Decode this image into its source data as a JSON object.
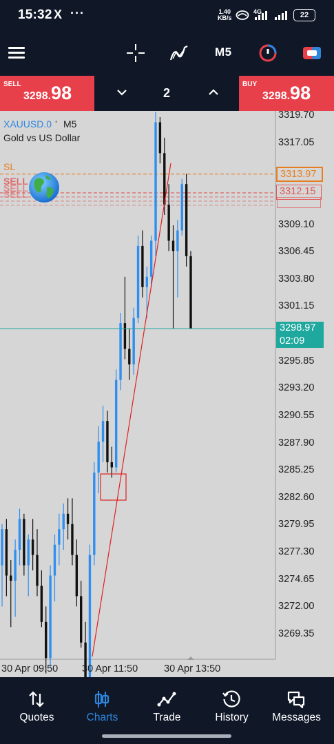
{
  "status_bar": {
    "time": "15:32",
    "x_icon": "X",
    "dots": "···",
    "speed_value": "1.40",
    "speed_unit": "KB/s",
    "network": "4G",
    "battery": "22"
  },
  "toolbar": {
    "timeframe": "M5"
  },
  "trade_panel": {
    "sell_label": "SELL",
    "sell_price_small": "3298.",
    "sell_price_big": "98",
    "lot": "2",
    "buy_label": "BUY",
    "buy_price_small": "3298.",
    "buy_price_big": "98"
  },
  "chart": {
    "symbol": "XAUUSD.0",
    "timeframe": "M5",
    "description": "Gold vs US Dollar",
    "sl_label": "SL",
    "sell_tag": "SELL",
    "sl_price": "3313.97",
    "sell_price": "3312.15",
    "current_price": "3298.97",
    "countdown": "02:09",
    "price_ticks": [
      "3319.70",
      "3317.05",
      "3309.10",
      "3306.45",
      "3303.80",
      "3301.15",
      "3295.85",
      "3293.20",
      "3290.55",
      "3287.90",
      "3285.25",
      "3282.60",
      "3279.95",
      "3277.30",
      "3274.65",
      "3272.00",
      "3269.35"
    ],
    "time_ticks": [
      "30 Apr 09:50",
      "30 Apr 11:50",
      "30 Apr 13:50"
    ],
    "colors": {
      "bull": "#2e8ff0",
      "bear": "#111111",
      "sl": "#e67e22",
      "sell": "#e05a5a",
      "bid_line": "#1fa89e"
    }
  },
  "chart_data": {
    "type": "candlestick",
    "symbol": "XAUUSD.0",
    "timeframe": "M5",
    "ylim": [
      3268.0,
      3321.0
    ],
    "candles": [
      [
        3276.0,
        3280.0,
        3272.0,
        3279.5
      ],
      [
        3279.5,
        3280.5,
        3273.0,
        3275.0
      ],
      [
        3275.0,
        3276.5,
        3270.0,
        3274.5
      ],
      [
        3274.5,
        3278.5,
        3271.0,
        3277.5
      ],
      [
        3277.5,
        3281.5,
        3276.0,
        3280.5
      ],
      [
        3280.5,
        3281.0,
        3275.0,
        3276.0
      ],
      [
        3276.0,
        3279.0,
        3273.0,
        3278.5
      ],
      [
        3278.5,
        3280.5,
        3275.5,
        3277.0
      ],
      [
        3277.0,
        3279.5,
        3273.0,
        3274.0
      ],
      [
        3274.0,
        3275.5,
        3270.0,
        3270.5
      ],
      [
        3270.5,
        3272.0,
        3265.5,
        3267.0
      ],
      [
        3267.0,
        3276.0,
        3266.0,
        3275.0
      ],
      [
        3275.0,
        3279.0,
        3272.5,
        3278.0
      ],
      [
        3278.0,
        3281.0,
        3276.0,
        3279.5
      ],
      [
        3279.5,
        3282.0,
        3277.5,
        3281.0
      ],
      [
        3281.0,
        3282.5,
        3278.5,
        3280.0
      ],
      [
        3280.0,
        3282.5,
        3276.0,
        3277.0
      ],
      [
        3277.0,
        3278.5,
        3272.0,
        3273.0
      ],
      [
        3273.0,
        3274.5,
        3268.0,
        3268.5
      ],
      [
        3268.5,
        3270.5,
        3264.5,
        3265.0
      ],
      [
        3265.0,
        3278.0,
        3264.5,
        3277.0
      ],
      [
        3277.0,
        3286.0,
        3276.0,
        3285.0
      ],
      [
        3285.0,
        3289.5,
        3283.0,
        3288.0
      ],
      [
        3288.0,
        3291.5,
        3286.0,
        3290.0
      ],
      [
        3290.0,
        3291.0,
        3285.0,
        3286.0
      ],
      [
        3286.0,
        3287.5,
        3284.5,
        3285.5
      ],
      [
        3285.5,
        3295.0,
        3285.0,
        3294.0
      ],
      [
        3294.0,
        3300.5,
        3293.0,
        3299.5
      ],
      [
        3299.5,
        3304.0,
        3296.0,
        3297.0
      ],
      [
        3297.0,
        3299.0,
        3294.0,
        3295.5
      ],
      [
        3295.5,
        3301.0,
        3294.5,
        3300.0
      ],
      [
        3300.0,
        3308.0,
        3299.5,
        3307.0
      ],
      [
        3307.0,
        3308.5,
        3302.0,
        3303.0
      ],
      [
        3303.0,
        3305.0,
        3300.0,
        3304.0
      ],
      [
        3304.0,
        3308.0,
        3303.0,
        3307.5
      ],
      [
        3307.5,
        3320.0,
        3306.0,
        3319.0
      ],
      [
        3319.0,
        3319.5,
        3315.0,
        3316.0
      ],
      [
        3316.0,
        3317.5,
        3310.0,
        3311.0
      ],
      [
        3311.0,
        3313.0,
        3306.5,
        3307.5
      ],
      [
        3307.5,
        3309.0,
        3299.0,
        3306.5
      ],
      [
        3306.5,
        3309.5,
        3302.0,
        3308.5
      ],
      [
        3308.5,
        3313.5,
        3308.0,
        3313.0
      ],
      [
        3313.0,
        3314.0,
        3305.0,
        3306.0
      ],
      [
        3306.0,
        3306.5,
        3298.97,
        3298.97
      ]
    ],
    "horizontal_lines": [
      {
        "label": "SL",
        "value": 3313.97
      },
      {
        "label": "SELL",
        "value": 3312.15
      }
    ],
    "current_price": 3298.97
  },
  "bottom_nav": {
    "items": [
      {
        "label": "Quotes",
        "icon": "quotes-icon"
      },
      {
        "label": "Charts",
        "icon": "charts-icon"
      },
      {
        "label": "Trade",
        "icon": "trade-icon"
      },
      {
        "label": "History",
        "icon": "history-icon"
      },
      {
        "label": "Messages",
        "icon": "messages-icon"
      }
    ],
    "active_color": "#2e86de"
  }
}
